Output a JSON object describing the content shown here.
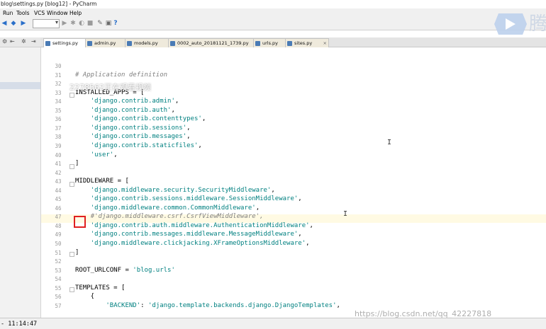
{
  "window": {
    "title": "blog\\settings.py [blog12] - PyCharm"
  },
  "menu": [
    "Run",
    "Tools",
    "VCS",
    "Window",
    "Help"
  ],
  "tabs": [
    {
      "label": "settings.py"
    },
    {
      "label": "admin.py"
    },
    {
      "label": "models.py"
    },
    {
      "label": "0002_auto_20181121_1739.py"
    },
    {
      "label": "urls.py"
    },
    {
      "label": "sites.py"
    }
  ],
  "active_tab": "settings.py",
  "editor": {
    "lines": [
      {
        "num": "30",
        "text": ""
      },
      {
        "num": "31",
        "text": "# Application definition",
        "kind": "comment"
      },
      {
        "num": "32",
        "text": ""
      },
      {
        "num": "33",
        "text": "INSTALLED_APPS = ["
      },
      {
        "num": "34",
        "text": "    'django.contrib.admin',",
        "kind": "string"
      },
      {
        "num": "35",
        "text": "    'django.contrib.auth',",
        "kind": "string"
      },
      {
        "num": "36",
        "text": "    'django.contrib.contenttypes',",
        "kind": "string"
      },
      {
        "num": "37",
        "text": "    'django.contrib.sessions',",
        "kind": "string"
      },
      {
        "num": "38",
        "text": "    'django.contrib.messages',",
        "kind": "string"
      },
      {
        "num": "39",
        "text": "    'django.contrib.staticfiles',",
        "kind": "string"
      },
      {
        "num": "40",
        "text": "    'user',",
        "kind": "string"
      },
      {
        "num": "41",
        "text": "]"
      },
      {
        "num": "42",
        "text": ""
      },
      {
        "num": "43",
        "text": "MIDDLEWARE = ["
      },
      {
        "num": "44",
        "text": "    'django.middleware.security.SecurityMiddleware',",
        "kind": "string"
      },
      {
        "num": "45",
        "text": "    'django.contrib.sessions.middleware.SessionMiddleware',",
        "kind": "string"
      },
      {
        "num": "46",
        "text": "    'django.middleware.common.CommonMiddleware',",
        "kind": "string"
      },
      {
        "num": "47",
        "text": "    #'django.middleware.csrf.CsrfViewMiddleware',",
        "kind": "comment"
      },
      {
        "num": "48",
        "text": "    'django.contrib.auth.middleware.AuthenticationMiddleware',",
        "kind": "string"
      },
      {
        "num": "49",
        "text": "    'django.contrib.messages.middleware.MessageMiddleware',",
        "kind": "string"
      },
      {
        "num": "50",
        "text": "    'django.middleware.clickjacking.XFrameOptionsMiddleware',",
        "kind": "string"
      },
      {
        "num": "51",
        "text": "]"
      },
      {
        "num": "52",
        "text": ""
      },
      {
        "num": "53",
        "text": "ROOT_URLCONF = 'blog.urls'",
        "kind": "assign"
      },
      {
        "num": "54",
        "text": ""
      },
      {
        "num": "55",
        "text": "TEMPLATES = ["
      },
      {
        "num": "56",
        "text": "    {"
      },
      {
        "num": "57",
        "text": "        'BACKEND': 'django.template.backends.django.DjangoTemplates',",
        "kind": "string"
      }
    ]
  },
  "overlay": {
    "viewers_text": "2278562正在观看视频",
    "watermark": "https://blog.csdn.net/qq_42227818"
  },
  "logo_char": "腾",
  "status": {
    "time": "- 11:14:47"
  },
  "colors": {
    "string": "#008080",
    "comment": "#808080",
    "highlight": "#e02020",
    "current_line": "#fffae3"
  },
  "icons": [
    "back-icon",
    "forward-icon",
    "run-icon",
    "debug-icon",
    "stop-icon",
    "help-icon",
    "settings-icon"
  ]
}
